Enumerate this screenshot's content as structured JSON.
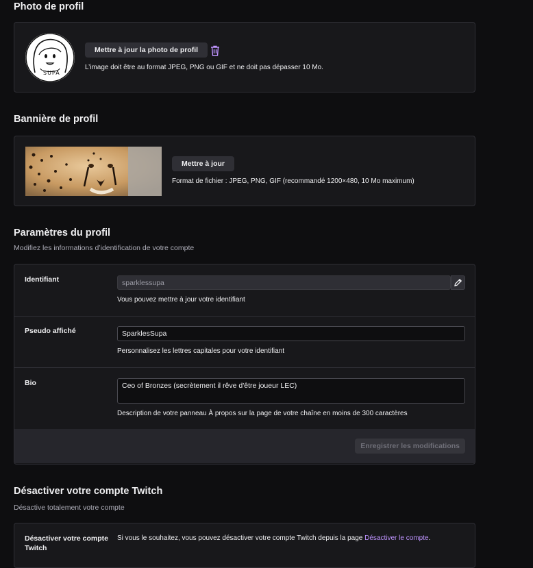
{
  "photo": {
    "title": "Photo de profil",
    "update_button": "Mettre à jour la photo de profil",
    "hint": "L’image doit être au format JPEG, PNG ou GIF et ne doit pas dépasser 10 Mo.",
    "avatar_text": "SUPA"
  },
  "banner": {
    "title": "Bannière de profil",
    "update_button": "Mettre à jour",
    "hint": "Format de fichier : JPEG, PNG, GIF (recommandé 1200×480, 10 Mo maximum)"
  },
  "settings": {
    "title": "Paramètres du profil",
    "subtitle": "Modifiez les informations d’identification de votre compte",
    "username": {
      "label": "Identifiant",
      "value": "sparklessupa",
      "hint": "Vous pouvez mettre à jour votre identifiant"
    },
    "display_name": {
      "label": "Pseudo affiché",
      "value": "SparklesSupa",
      "hint": "Personnalisez les lettres capitales pour votre identifiant"
    },
    "bio": {
      "label": "Bio",
      "value": "Ceo of Bronzes (secrètement il rêve d'être joueur LEC)",
      "hint": "Description de votre panneau À propos sur la page de votre chaîne en moins de 300 caractères"
    },
    "save_button": "Enregistrer les modifications"
  },
  "disable": {
    "title": "Désactiver votre compte Twitch",
    "subtitle": "Désactive totalement votre compte",
    "label": "Désactiver votre compte Twitch",
    "text": "Si vous le souhaitez, vous pouvez désactiver votre compte Twitch depuis la page",
    "link": "Désactiver le compte",
    "period": "."
  },
  "colors": {
    "accent": "#bf94ff",
    "background": "#0e0e10",
    "card": "#18181b"
  },
  "icons": {
    "trash": "trash-icon",
    "edit": "pencil-icon"
  }
}
